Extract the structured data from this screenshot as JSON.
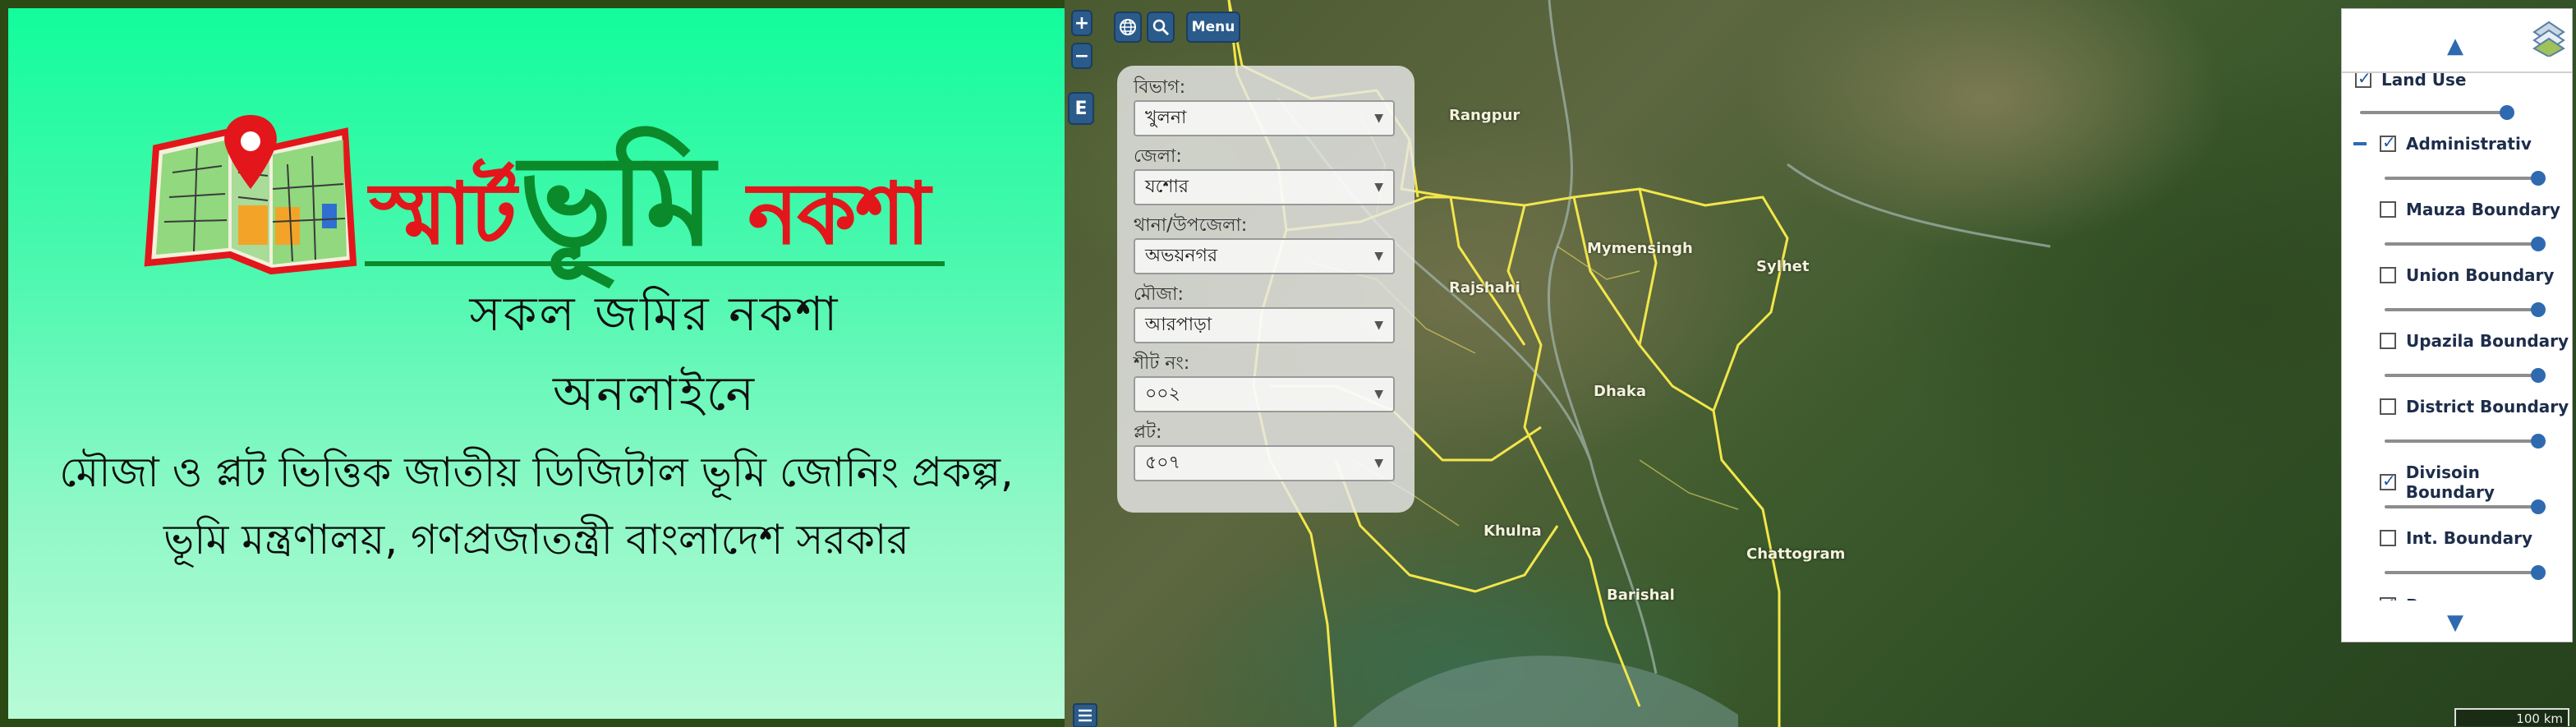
{
  "banner": {
    "brand_smart": "স্মার্ট",
    "brand_bhumi": "ভূমি",
    "brand_noksha": "নকশা",
    "tagline": "সকল জমির নকশা অনলাইনে",
    "project_line1": "মৌজা ও প্লট ভিত্তিক জাতীয় ডিজিটাল ভূমি জোনিং প্রকল্প,",
    "project_line2": "ভূমি মন্ত্রণালয়, গণপ্রজাতন্ত্রী বাংলাদেশ সরকার",
    "colors": {
      "red": "#e3161b",
      "green": "#0b8a2b"
    }
  },
  "toolbar": {
    "zoom_in": "+",
    "zoom_out": "−",
    "menu": "Menu",
    "e_button": "E",
    "icons": [
      "globe-icon",
      "search-icon",
      "list-icon"
    ]
  },
  "selection": {
    "fields": [
      {
        "label": "বিভাগ:",
        "value": "খুলনা"
      },
      {
        "label": "জেলা:",
        "value": "যশোর"
      },
      {
        "label": "থানা/উপজেলা:",
        "value": "অভয়নগর"
      },
      {
        "label": "মৌজা:",
        "value": "আরপাড়া"
      },
      {
        "label": "শীট নং:",
        "value": "০০২"
      },
      {
        "label": "প্লট:",
        "value": "৫০৭"
      }
    ]
  },
  "map": {
    "cities": [
      "Rangpur",
      "Mymensingh",
      "Sylhet",
      "Rajshahi",
      "Dhaka",
      "Khulna",
      "Barishal",
      "Chattogram"
    ],
    "scale": "100 km",
    "boundary_color": "#f2e64a"
  },
  "layers": {
    "items": [
      {
        "label": "Land Use",
        "checked": true
      },
      {
        "label": "Administrativ",
        "checked": true
      },
      {
        "label": "Mauza Boundary",
        "checked": false
      },
      {
        "label": "Union Boundary",
        "checked": false
      },
      {
        "label": "Upazila Boundary",
        "checked": false
      },
      {
        "label": "District Boundary",
        "checked": false
      },
      {
        "label": "Divisoin Boundary",
        "checked": true
      },
      {
        "label": "Int. Boundary",
        "checked": false
      },
      {
        "label": "Base maps",
        "checked": true
      }
    ]
  }
}
